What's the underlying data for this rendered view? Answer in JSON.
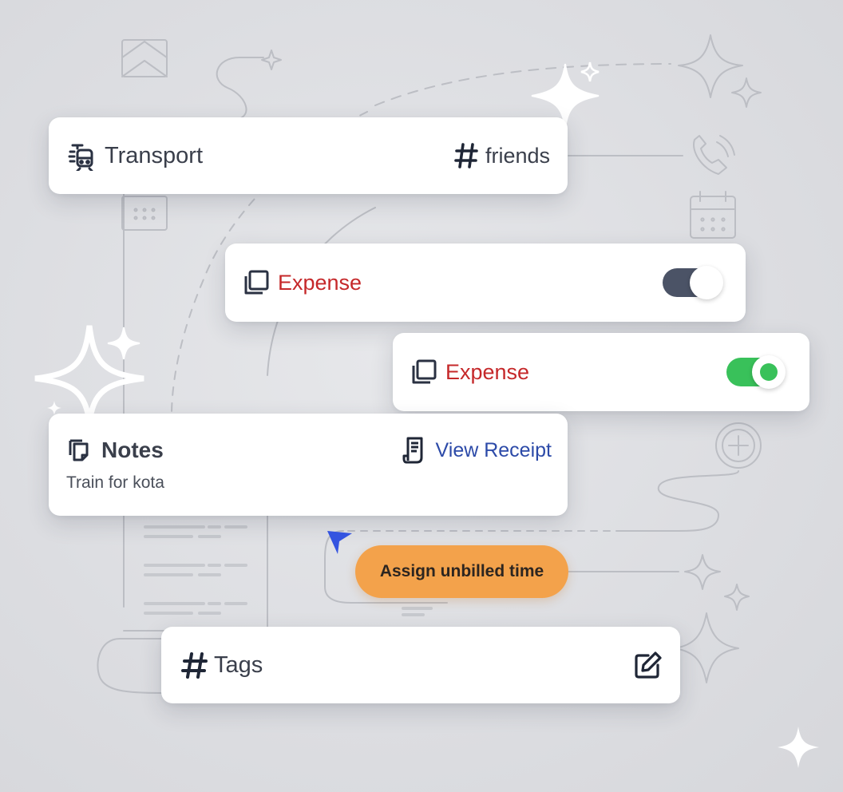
{
  "transport_card": {
    "label": "Transport",
    "tag": "friends",
    "icon": "train-icon",
    "tag_icon": "hash-icon"
  },
  "expense_cards": [
    {
      "label": "Expense",
      "icon": "copy-icon",
      "toggle_on": false,
      "label_color": "#c5282a",
      "toggle_color": "#4b5366"
    },
    {
      "label": "Expense",
      "icon": "copy-icon",
      "toggle_on": true,
      "label_color": "#c5282a",
      "toggle_color": "#39c15a"
    }
  ],
  "notes_card": {
    "title": "Notes",
    "text": "Train for kota",
    "receipt_link": "View Receipt",
    "icon": "notes-icon",
    "receipt_icon": "receipt-icon",
    "link_color": "#2c4aa8"
  },
  "assign_button": {
    "label": "Assign unbilled time",
    "color": "#f3a24b"
  },
  "tags_card": {
    "label": "Tags",
    "icon": "hash-icon",
    "edit_icon": "edit-icon"
  }
}
